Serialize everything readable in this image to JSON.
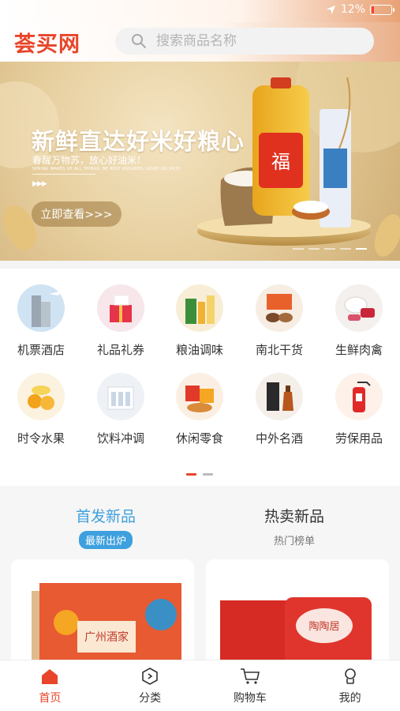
{
  "status_bar": {
    "battery": "12%",
    "battery_level": 0.12
  },
  "header": {
    "logo": "荟买网",
    "search_placeholder": "搜索商品名称"
  },
  "banner": {
    "title": "新鲜直达好米好粮心",
    "subtitle": "春醒万物苏，放心好油米！",
    "english": "SPRING WAKES UP ALL THINGS, BE REST ASSURED, GOOD OIL RICE!",
    "arrows": "▶▶▶",
    "button": "立即查看>>>",
    "oil_label": "福",
    "slide_count": 5,
    "active_slide": 4
  },
  "categories": [
    {
      "label": "机票酒店",
      "icon": "hotel-building-icon"
    },
    {
      "label": "礼品礼券",
      "icon": "gift-box-icon"
    },
    {
      "label": "粮油调味",
      "icon": "grain-oil-icon"
    },
    {
      "label": "南北干货",
      "icon": "dried-goods-icon"
    },
    {
      "label": "生鲜肉禽",
      "icon": "fresh-meat-icon"
    },
    {
      "label": "时令水果",
      "icon": "fruit-icon"
    },
    {
      "label": "饮料冲调",
      "icon": "beverage-icon"
    },
    {
      "label": "休闲零食",
      "icon": "snack-icon"
    },
    {
      "label": "中外名酒",
      "icon": "liquor-icon"
    },
    {
      "label": "劳保用品",
      "icon": "fire-extinguisher-icon"
    }
  ],
  "category_pages": {
    "count": 2,
    "active": 1
  },
  "tabs": [
    {
      "title": "首发新品",
      "subtitle": "最新出炉",
      "active": true
    },
    {
      "title": "热卖新品",
      "subtitle": "热门榜单",
      "active": false
    }
  ],
  "products": [
    {
      "name": "product-card-gift-box",
      "brand_text": "广州酒家"
    },
    {
      "name": "product-card-mooncake-box",
      "brand_text": "陶陶居"
    }
  ],
  "bottom_nav": [
    {
      "label": "首页",
      "icon": "home-icon",
      "active": true
    },
    {
      "label": "分类",
      "icon": "category-icon",
      "active": false
    },
    {
      "label": "购物车",
      "icon": "cart-icon",
      "active": false
    },
    {
      "label": "我的",
      "icon": "profile-icon",
      "active": false
    }
  ],
  "colors": {
    "brand_red": "#e8452a",
    "tab_blue": "#3ea0de",
    "banner_gold": "#d9b57c"
  }
}
